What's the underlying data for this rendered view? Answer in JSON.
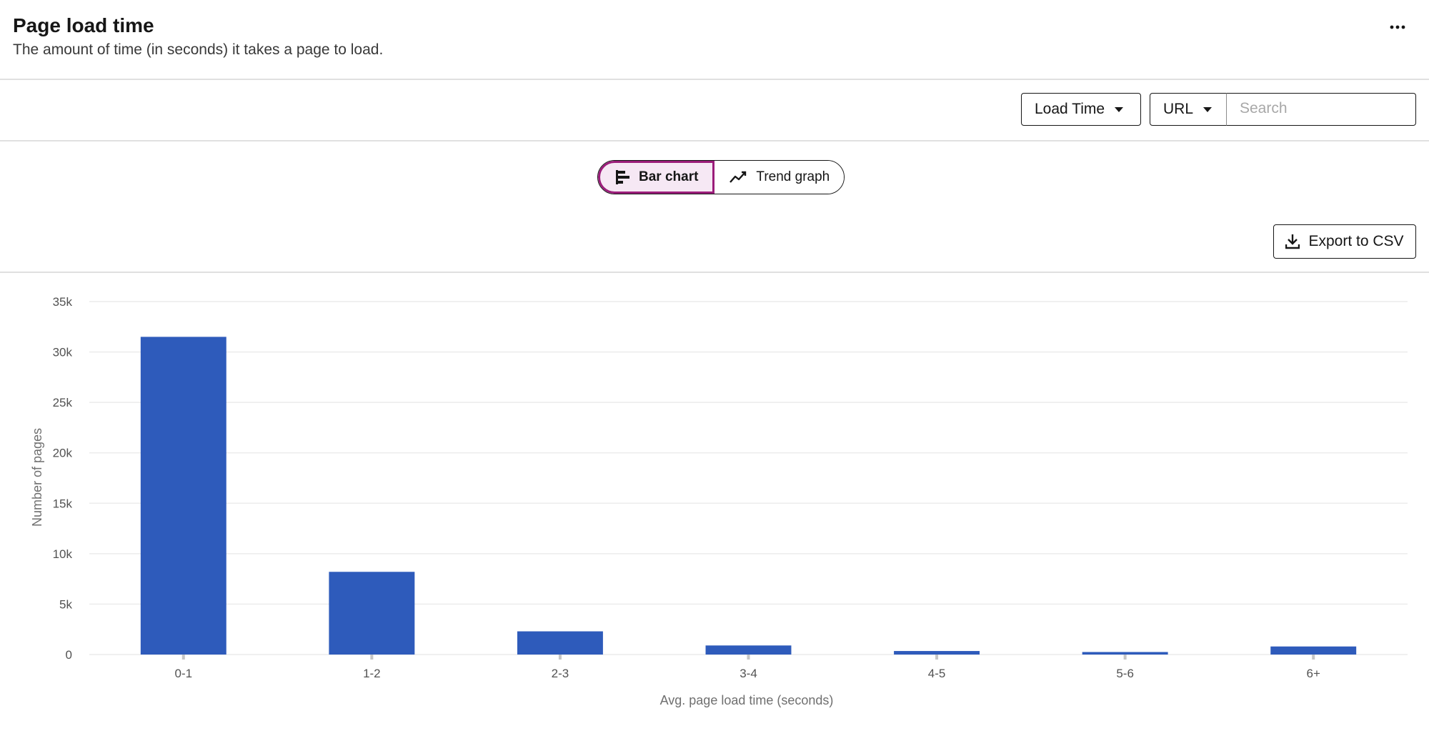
{
  "header": {
    "title": "Page load time",
    "subtitle": "The amount of time (in seconds) it takes a page to load.",
    "more_icon": "overflow-menu-icon"
  },
  "filters": {
    "metric_dropdown": "Load Time",
    "dimension_dropdown": "URL",
    "search_placeholder": "Search",
    "search_value": ""
  },
  "view_toggle": {
    "bar_label": "Bar chart",
    "trend_label": "Trend graph",
    "selected": "Bar chart",
    "accent_color": "#9b1d7a"
  },
  "export": {
    "label": "Export to CSV",
    "icon": "download-icon"
  },
  "chart_data": {
    "type": "bar",
    "categories": [
      "0-1",
      "1-2",
      "2-3",
      "3-4",
      "4-5",
      "5-6",
      "6+"
    ],
    "values": [
      31500,
      8200,
      2300,
      900,
      350,
      250,
      800
    ],
    "xlabel": "Avg. page load time (seconds)",
    "ylabel": "Number of pages",
    "ylim": [
      0,
      35000
    ],
    "yticks": [
      0,
      5000,
      10000,
      15000,
      20000,
      25000,
      30000,
      35000
    ],
    "ytick_labels": [
      "0",
      "5k",
      "10k",
      "15k",
      "20k",
      "25k",
      "30k",
      "35k"
    ],
    "bar_color": "#2e5bbb",
    "grid": true
  }
}
